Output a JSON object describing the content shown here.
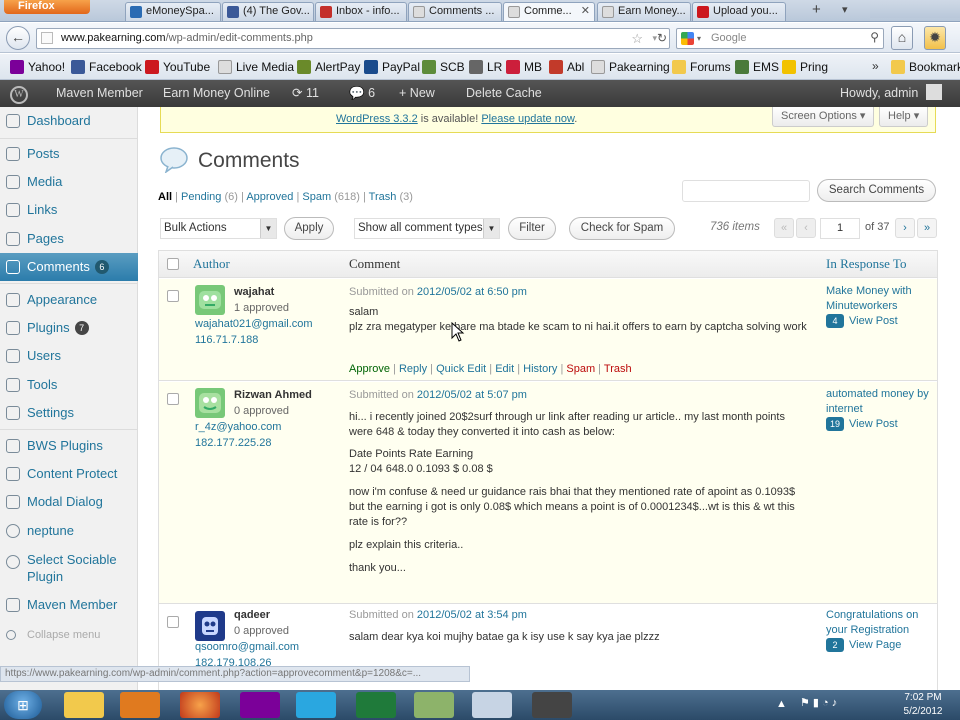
{
  "browser": {
    "app_button": "Firefox",
    "tabs": [
      {
        "label": "eMoneySpa...",
        "color": "#2a6bb3"
      },
      {
        "label": "(4) The Gov...",
        "color": "#3b5998"
      },
      {
        "label": "Inbox - info...",
        "color": "#c4302b"
      },
      {
        "label": "Comments ...",
        "color": "#cccccc"
      },
      {
        "label": "Comme...",
        "color": "#cccccc"
      },
      {
        "label": "Earn Money...",
        "color": "#cccccc"
      },
      {
        "label": "Upload you...",
        "color": "#cc181e"
      }
    ],
    "url_host": "www.pakearning.com",
    "url_path": "/wp-admin/edit-comments.php",
    "search_placeholder": "Google",
    "bookmarks": [
      {
        "label": "Yahoo!",
        "color": "#7b0099"
      },
      {
        "label": "Facebook",
        "color": "#3b5998"
      },
      {
        "label": "YouTube",
        "color": "#cc181e"
      },
      {
        "label": "Live Media",
        "color": "#dddddd"
      },
      {
        "label": "AlertPay",
        "color": "#6a8a2a"
      },
      {
        "label": "PayPal",
        "color": "#1a4b8c"
      },
      {
        "label": "SCB",
        "color": "#5d8c3a"
      },
      {
        "label": "LR",
        "color": "#666666"
      },
      {
        "label": "MB",
        "color": "#cc1f3b"
      },
      {
        "label": "Abl",
        "color": "#c23a2a"
      },
      {
        "label": "Pakearning",
        "color": "#dddddd"
      },
      {
        "label": "Forums",
        "color": "#f2c94c"
      },
      {
        "label": "EMS",
        "color": "#4a7a3a"
      },
      {
        "label": "Pring",
        "color": "#f2c200"
      },
      {
        "label": "Bookmark",
        "color": "#f2c94c"
      }
    ],
    "status_url": "https://www.pakearning.com/wp-admin/comment.php?action=approvecomment&p=1208&c=..."
  },
  "adminbar": {
    "items": [
      "Maven Member",
      "Earn Money Online",
      "11",
      "6",
      "New",
      "Delete Cache"
    ],
    "howdy": "Howdy, admin"
  },
  "sidebar": {
    "items": [
      {
        "label": "Dashboard"
      },
      {
        "label": "Posts"
      },
      {
        "label": "Media"
      },
      {
        "label": "Links"
      },
      {
        "label": "Pages"
      },
      {
        "label": "Comments",
        "badge": "6"
      },
      {
        "label": "Appearance"
      },
      {
        "label": "Plugins",
        "badge": "7"
      },
      {
        "label": "Users"
      },
      {
        "label": "Tools"
      },
      {
        "label": "Settings"
      },
      {
        "label": "BWS Plugins"
      },
      {
        "label": "Content Protect"
      },
      {
        "label": "Modal Dialog"
      },
      {
        "label": "neptune"
      },
      {
        "label": "Select Sociable Plugin"
      },
      {
        "label": "Maven Member"
      },
      {
        "label": "Collapse menu"
      }
    ]
  },
  "notice": {
    "link1": "WordPress 3.3.2",
    "text": " is available! ",
    "link2": "Please update now",
    "end": "."
  },
  "screen_options": "Screen Options",
  "help": "Help",
  "page_title": "Comments",
  "filters": {
    "all": "All",
    "pending": "Pending",
    "pending_count": "(6)",
    "approved": "Approved",
    "spam": "Spam",
    "spam_count": "(618)",
    "trash": "Trash",
    "trash_count": "(3)"
  },
  "search_button": "Search Comments",
  "bulk_actions": "Bulk Actions",
  "apply": "Apply",
  "comment_type": "Show all comment types",
  "filter": "Filter",
  "check_spam": "Check for Spam",
  "items_count": "736 items",
  "page_current": "1",
  "page_total": "of 37",
  "columns": {
    "author": "Author",
    "comment": "Comment",
    "response": "In Response To"
  },
  "comments": [
    {
      "author": "wajahat",
      "approved": "1 approved",
      "email": "wajahat021@gmail.com",
      "ip": "116.71.7.188",
      "submitted": "Submitted on ",
      "date": "2012/05/02 at 6:50 pm",
      "lines": [
        "salam",
        "plz zra megatyper ke bare ma btade ke scam to ni hai.it offers to earn by captcha solving work"
      ],
      "actions": {
        "approve": "Approve",
        "reply": "Reply",
        "quick_edit": "Quick Edit",
        "edit": "Edit",
        "history": "History",
        "spam": "Spam",
        "trash": "Trash"
      },
      "post": "Make Money with Minuteworkers",
      "bubble": "4",
      "view": "View Post",
      "avatar_color": "#78c878"
    },
    {
      "author": "Rizwan Ahmed",
      "approved": "0 approved",
      "email": "r_4z@yahoo.com",
      "ip": "182.177.225.28",
      "submitted": "Submitted on ",
      "date": "2012/05/02 at 5:07 pm",
      "lines": [
        "hi... i recently joined 20$2surf through ur link after reading ur article.. my last month points were 648 & today they converted it into cash as below:",
        "Date Points Rate Earning",
        "12 / 04 648.0 0.1093 $ 0.08 $",
        "now i'm confuse & need ur guidance rais bhai that they mentioned rate of apoint as 0.1093$ but the earning i got is only 0.08$ which means a point is of 0.0001234$...wt is this & wt this rate is for??",
        "plz explain this criteria..",
        "thank you..."
      ],
      "post": "automated money by internet",
      "bubble": "19",
      "view": "View Post",
      "avatar_color": "#78c878"
    },
    {
      "author": "qadeer",
      "approved": "0 approved",
      "email": "qsoomro@gmail.com",
      "ip": "182.179.108.26",
      "submitted": "Submitted on ",
      "date": "2012/05/02 at 3:54 pm",
      "lines": [
        "salam dear kya koi mujhy bataе ga k isy use k say kya jae plzzz"
      ],
      "post": "Congratulations on your Registration",
      "bubble": "2",
      "view": "View Page",
      "avatar_color": "#1f3a8a"
    }
  ],
  "clock": {
    "time": "7:02 PM",
    "date": "5/2/2012"
  }
}
